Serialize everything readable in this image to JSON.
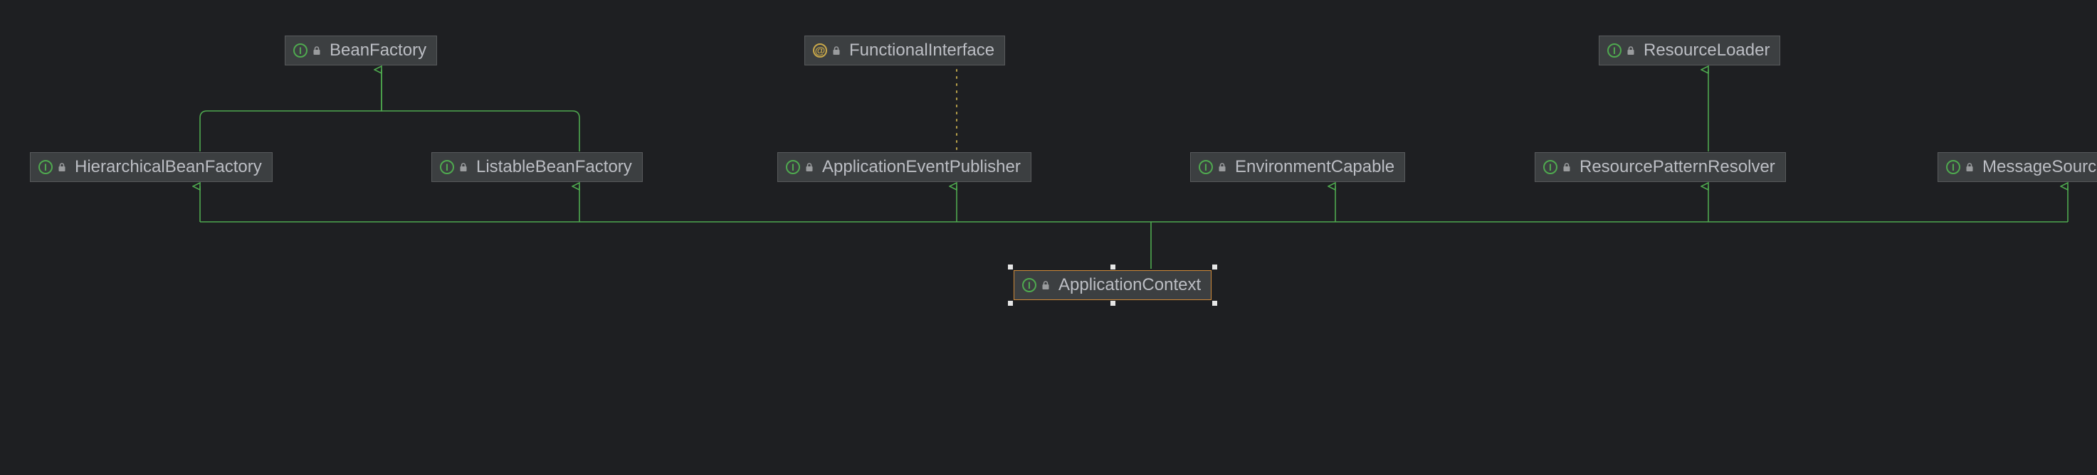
{
  "nodes": {
    "beanFactory": {
      "label": "BeanFactory",
      "kind": "interface"
    },
    "functionalInterface": {
      "label": "FunctionalInterface",
      "kind": "annotation"
    },
    "resourceLoader": {
      "label": "ResourceLoader",
      "kind": "interface"
    },
    "hierarchicalBeanFactory": {
      "label": "HierarchicalBeanFactory",
      "kind": "interface"
    },
    "listableBeanFactory": {
      "label": "ListableBeanFactory",
      "kind": "interface"
    },
    "applicationEventPublisher": {
      "label": "ApplicationEventPublisher",
      "kind": "interface"
    },
    "environmentCapable": {
      "label": "EnvironmentCapable",
      "kind": "interface"
    },
    "resourcePatternResolver": {
      "label": "ResourcePatternResolver",
      "kind": "interface"
    },
    "messageSource": {
      "label": "MessageSource",
      "kind": "interface"
    },
    "applicationContext": {
      "label": "ApplicationContext",
      "kind": "interface",
      "selected": true
    }
  },
  "edges": [
    {
      "from": "hierarchicalBeanFactory",
      "to": "beanFactory",
      "relation": "extends"
    },
    {
      "from": "listableBeanFactory",
      "to": "beanFactory",
      "relation": "extends"
    },
    {
      "from": "applicationEventPublisher",
      "to": "functionalInterface",
      "relation": "annotated-by"
    },
    {
      "from": "resourcePatternResolver",
      "to": "resourceLoader",
      "relation": "extends"
    },
    {
      "from": "applicationContext",
      "to": "hierarchicalBeanFactory",
      "relation": "extends"
    },
    {
      "from": "applicationContext",
      "to": "listableBeanFactory",
      "relation": "extends"
    },
    {
      "from": "applicationContext",
      "to": "applicationEventPublisher",
      "relation": "extends"
    },
    {
      "from": "applicationContext",
      "to": "environmentCapable",
      "relation": "extends"
    },
    {
      "from": "applicationContext",
      "to": "resourcePatternResolver",
      "relation": "extends"
    },
    {
      "from": "applicationContext",
      "to": "messageSource",
      "relation": "extends"
    }
  ],
  "colors": {
    "background": "#1e1f22",
    "nodeFill": "#3c3f41",
    "nodeBorder": "#585a5c",
    "selectedBorder": "#d08a3a",
    "edgeGeneralization": "#4fa94f",
    "edgeAnnotation": "#b8a14a",
    "text": "#bcbec4"
  }
}
